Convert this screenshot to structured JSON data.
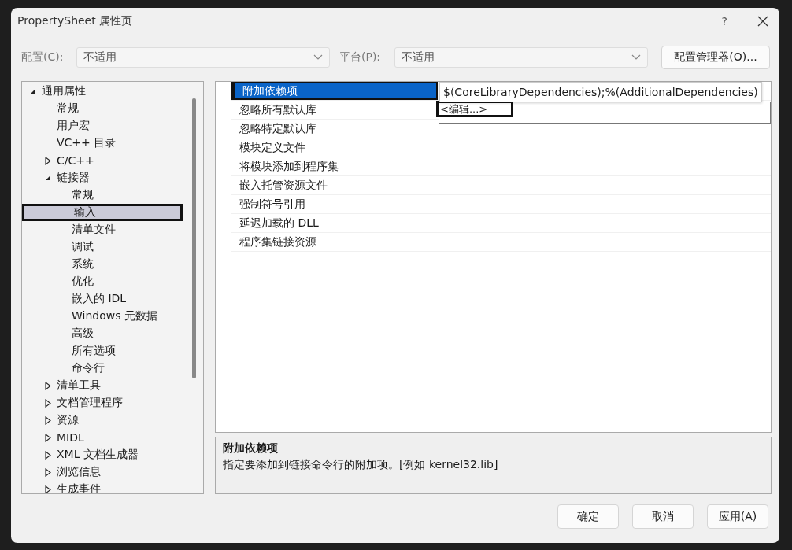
{
  "window": {
    "title": "PropertySheet 属性页",
    "help": "?"
  },
  "configuration": {
    "label": "配置(C):",
    "value": "不适用"
  },
  "platform": {
    "label": "平台(P):",
    "value": "不适用"
  },
  "config_manager_button": "配置管理器(O)...",
  "tree": [
    {
      "label": "通用属性",
      "selected": false,
      "expanded": true,
      "children": [
        {
          "label": "常规",
          "selected": false
        },
        {
          "label": "用户宏",
          "selected": false
        },
        {
          "label": "VC++ 目录",
          "selected": false
        },
        {
          "label": "C/C++",
          "selected": false,
          "expanded": false
        },
        {
          "label": "链接器",
          "selected": false,
          "expanded": true,
          "children": [
            {
              "label": "常规",
              "selected": false
            },
            {
              "label": "输入",
              "selected": true
            },
            {
              "label": "清单文件",
              "selected": false
            },
            {
              "label": "调试",
              "selected": false
            },
            {
              "label": "系统",
              "selected": false
            },
            {
              "label": "优化",
              "selected": false
            },
            {
              "label": "嵌入的 IDL",
              "selected": false
            },
            {
              "label": "Windows 元数据",
              "selected": false
            },
            {
              "label": "高级",
              "selected": false
            },
            {
              "label": "所有选项",
              "selected": false
            },
            {
              "label": "命令行",
              "selected": false
            }
          ]
        },
        {
          "label": "清单工具",
          "selected": false,
          "expanded": false
        },
        {
          "label": "文档管理程序",
          "selected": false,
          "expanded": false
        },
        {
          "label": "资源",
          "selected": false,
          "expanded": false
        },
        {
          "label": "MIDL",
          "selected": false,
          "expanded": false
        },
        {
          "label": "XML 文档生成器",
          "selected": false,
          "expanded": false
        },
        {
          "label": "浏览信息",
          "selected": false,
          "expanded": false
        },
        {
          "label": "生成事件",
          "selected": false,
          "expanded": false
        }
      ]
    }
  ],
  "properties": [
    {
      "name": "附加依赖项",
      "value": "$(CoreLibraryDependencies);%(AdditionalDependencies)",
      "selected": true
    },
    {
      "name": "忽略所有默认库",
      "selected": false
    },
    {
      "name": "忽略特定默认库",
      "selected": false
    },
    {
      "name": "模块定义文件",
      "selected": false
    },
    {
      "name": "将模块添加到程序集",
      "selected": false
    },
    {
      "name": "嵌入托管资源文件",
      "selected": false
    },
    {
      "name": "强制符号引用",
      "selected": false
    },
    {
      "name": "延迟加载的 DLL",
      "selected": false
    },
    {
      "name": "程序集链接资源",
      "selected": false
    }
  ],
  "value_dropdown": {
    "option": "<编辑...>"
  },
  "description": {
    "title": "附加依赖项",
    "text": "指定要添加到链接命令行的附加项。[例如 kernel32.lib]"
  },
  "buttons": [
    "确定",
    "取消",
    "应用(A)"
  ]
}
